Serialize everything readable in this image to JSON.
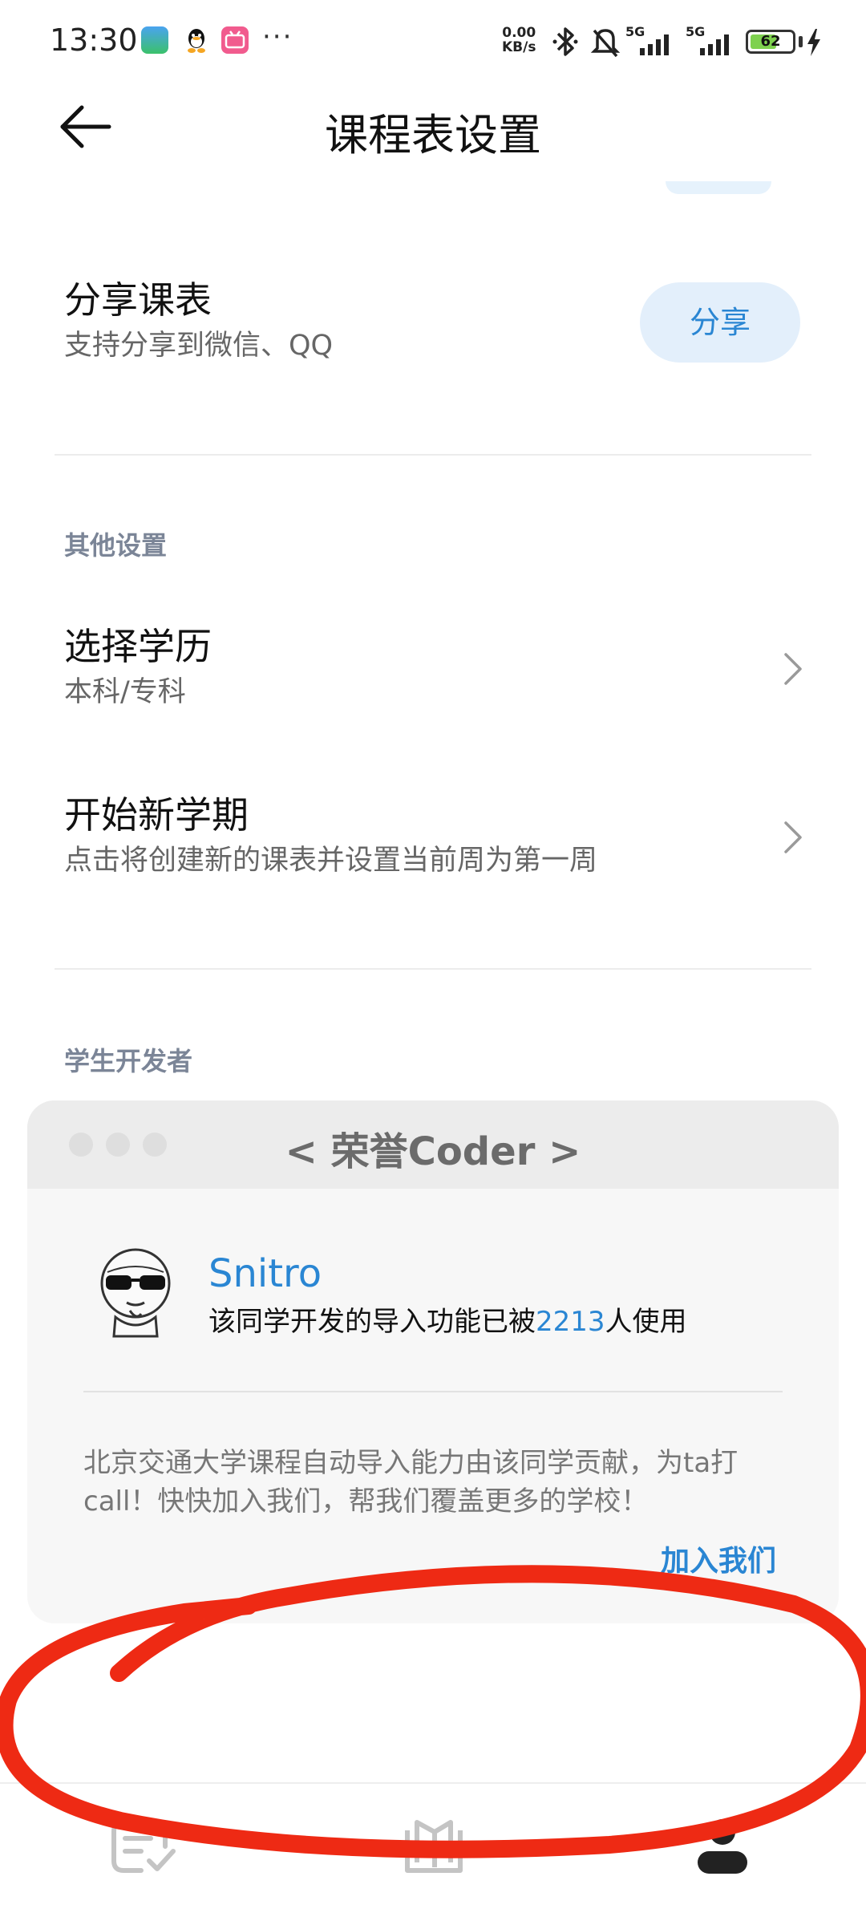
{
  "status_bar": {
    "time": "13:30",
    "more": "···",
    "net_speed_value": "0.00",
    "net_speed_unit": "KB/s",
    "sim1": "5G",
    "sim2": "5G",
    "battery_level": "62",
    "icons": [
      "gallery-icon",
      "qq-icon",
      "bilibili-icon",
      "bluetooth-icon",
      "mute-bell-icon",
      "signal-icon",
      "signal-icon",
      "battery-icon",
      "charging-icon"
    ]
  },
  "header": {
    "title": "课程表设置",
    "back_icon": "arrow-left-icon"
  },
  "share_row": {
    "title": "分享课表",
    "subtitle": "支持分享到微信、QQ",
    "button": "分享"
  },
  "other_settings": {
    "label": "其他设置",
    "items": [
      {
        "title": "选择学历",
        "subtitle": "本科/专科"
      },
      {
        "title": "开始新学期",
        "subtitle": "点击将创建新的课表并设置当前周为第一周"
      }
    ]
  },
  "developer_section": {
    "label": "学生开发者",
    "card": {
      "title": "< 荣誉Coder >",
      "name": "Snitro",
      "usage_prefix": "该同学开发的导入功能已被",
      "usage_count": "2213",
      "usage_suffix": "人使用",
      "description": "北京交通大学课程自动导入能力由该同学贡献，为ta打call！快快加入我们，帮我们覆盖更多的学校！",
      "join": "加入我们"
    }
  },
  "colors": {
    "accent": "#2a86d3",
    "share_button_bg": "#e3effb",
    "section_label": "#7b8597",
    "scribble": "#ee2a14"
  },
  "bottom_nav": {
    "items": [
      "schedule-check-icon",
      "book-icon",
      "profile-icon"
    ],
    "active_index": 2
  }
}
